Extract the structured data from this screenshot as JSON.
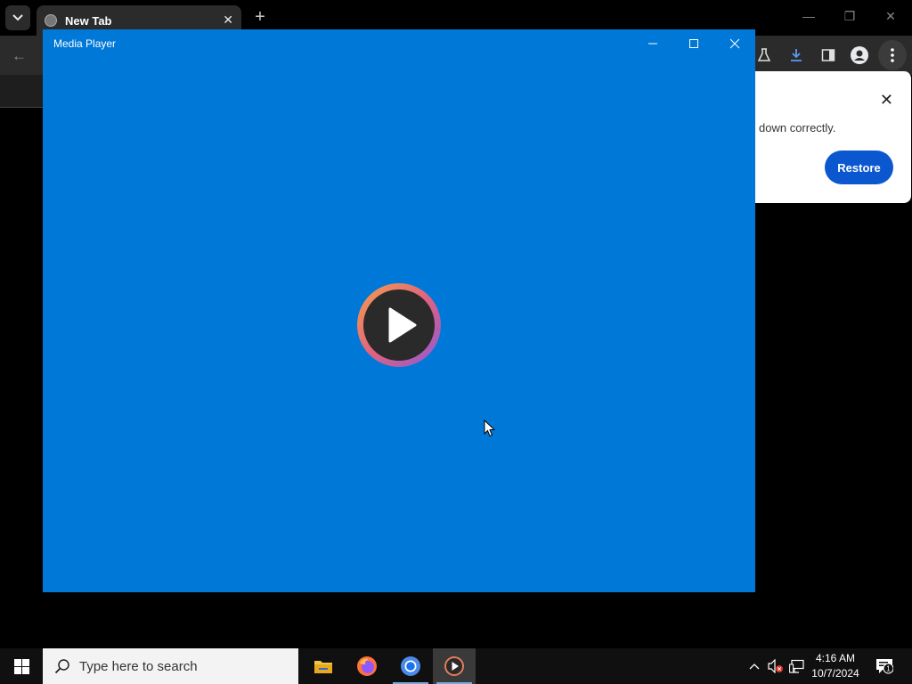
{
  "chrome": {
    "tab_title": "New Tab",
    "tab_close": "✕",
    "new_tab": "+",
    "window_minimize": "—",
    "window_restore": "❐",
    "window_close": "✕",
    "back": "←"
  },
  "restore_popup": {
    "message": "down correctly.",
    "restore_label": "Restore",
    "close": "✕"
  },
  "media_player": {
    "title": "Media Player"
  },
  "taskbar": {
    "search_placeholder": "Type here to search",
    "apps": [
      "file-explorer",
      "firefox",
      "chrome",
      "media-player"
    ],
    "time": "4:16 AM",
    "date": "10/7/2024",
    "notification_count": "1"
  },
  "colors": {
    "media_player_bg": "#0078d7",
    "restore_button": "#0b57d0",
    "taskbar": "#101010"
  }
}
